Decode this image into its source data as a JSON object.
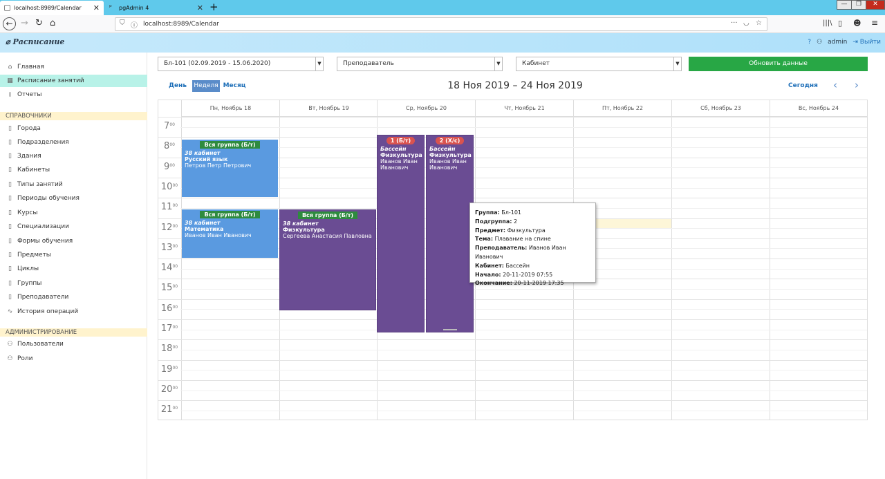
{
  "browser": {
    "tabs": [
      {
        "title": "localhost:8989/Calendar"
      },
      {
        "title": "pgAdmin 4"
      }
    ],
    "url": "localhost:8989/Calendar"
  },
  "header": {
    "brand": "Расписание",
    "user": "admin",
    "logout": "Выйти"
  },
  "sidebar": {
    "main": [
      {
        "label": "Главная",
        "icon": "home-icon"
      },
      {
        "label": "Расписание занятий",
        "icon": "calendar-icon"
      },
      {
        "label": "Отчеты",
        "icon": "chart-icon"
      }
    ],
    "section1": "СПРАВОЧНИКИ",
    "refs": [
      {
        "label": "Города"
      },
      {
        "label": "Подразделения"
      },
      {
        "label": "Здания"
      },
      {
        "label": "Кабинеты"
      },
      {
        "label": "Типы занятий"
      },
      {
        "label": "Периоды обучения"
      },
      {
        "label": "Курсы"
      },
      {
        "label": "Специализации"
      },
      {
        "label": "Формы обучения"
      },
      {
        "label": "Предметы"
      },
      {
        "label": "Циклы"
      },
      {
        "label": "Группы"
      },
      {
        "label": "Преподаватели"
      },
      {
        "label": "История операций"
      }
    ],
    "section2": "АДМИНИСТРИРОВАНИЕ",
    "admin": [
      {
        "label": "Пользователи"
      },
      {
        "label": "Роли"
      }
    ]
  },
  "filters": {
    "group": "Бл-101 (02.09.2019 - 15.06.2020)",
    "teacher": "Преподаватель",
    "room": "Кабинет",
    "refresh": "Обновить данные"
  },
  "views": {
    "day": "День",
    "week": "Неделя",
    "month": "Месяц",
    "today": "Сегодня"
  },
  "calendar": {
    "title": "18 Ноя 2019 – 24 Ноя 2019",
    "days": [
      "Пн, Ноябрь 18",
      "Вт, Ноябрь 19",
      "Ср, Ноябрь 20",
      "Чт, Ноябрь 21",
      "Пт, Ноябрь 22",
      "Сб, Ноябрь 23",
      "Вс, Ноябрь 24"
    ],
    "hours": [
      "7",
      "8",
      "9",
      "10",
      "11",
      "12",
      "13",
      "14",
      "15",
      "16",
      "17",
      "18",
      "19",
      "20",
      "21"
    ],
    "minutes": "00"
  },
  "events": [
    {
      "badge": "Вся группа (Б/т)",
      "room": "38 кабинет",
      "subject": "Русский язык",
      "teacher": "Петров Петр Петрович"
    },
    {
      "badge": "Вся группа (Б/т)",
      "room": "38 кабинет",
      "subject": "Математика",
      "teacher": "Иванов Иван Иванович"
    },
    {
      "badge": "Вся группа (Б/т)",
      "room": "38 кабинет",
      "subject": "Физкультура",
      "teacher": "Сергеева Анастасия Павловна"
    },
    {
      "badge": "1 (Б/т)",
      "room": "Бассейн",
      "subject": "Физкультура",
      "teacher": "Иванов Иван Иванович"
    },
    {
      "badge": "2 (Х/с)",
      "room": "Бассейн",
      "subject": "Физкультура",
      "teacher": "Иванов Иван Иванович"
    }
  ],
  "tooltip": {
    "group_k": "Группа:",
    "group_v": "Бл-101",
    "sub_k": "Подгруппа:",
    "sub_v": "2",
    "subj_k": "Предмет:",
    "subj_v": "Физкультура",
    "topic_k": "Тема:",
    "topic_v": "Плавание на спине",
    "teach_k": "Преподаватель:",
    "teach_v": "Иванов Иван Иванович",
    "room_k": "Кабинет:",
    "room_v": "Бассейн",
    "start_k": "Начало:",
    "start_v": "20-11-2019 07:55",
    "end_k": "Окончание:",
    "end_v": "20-11-2019 17:35"
  }
}
